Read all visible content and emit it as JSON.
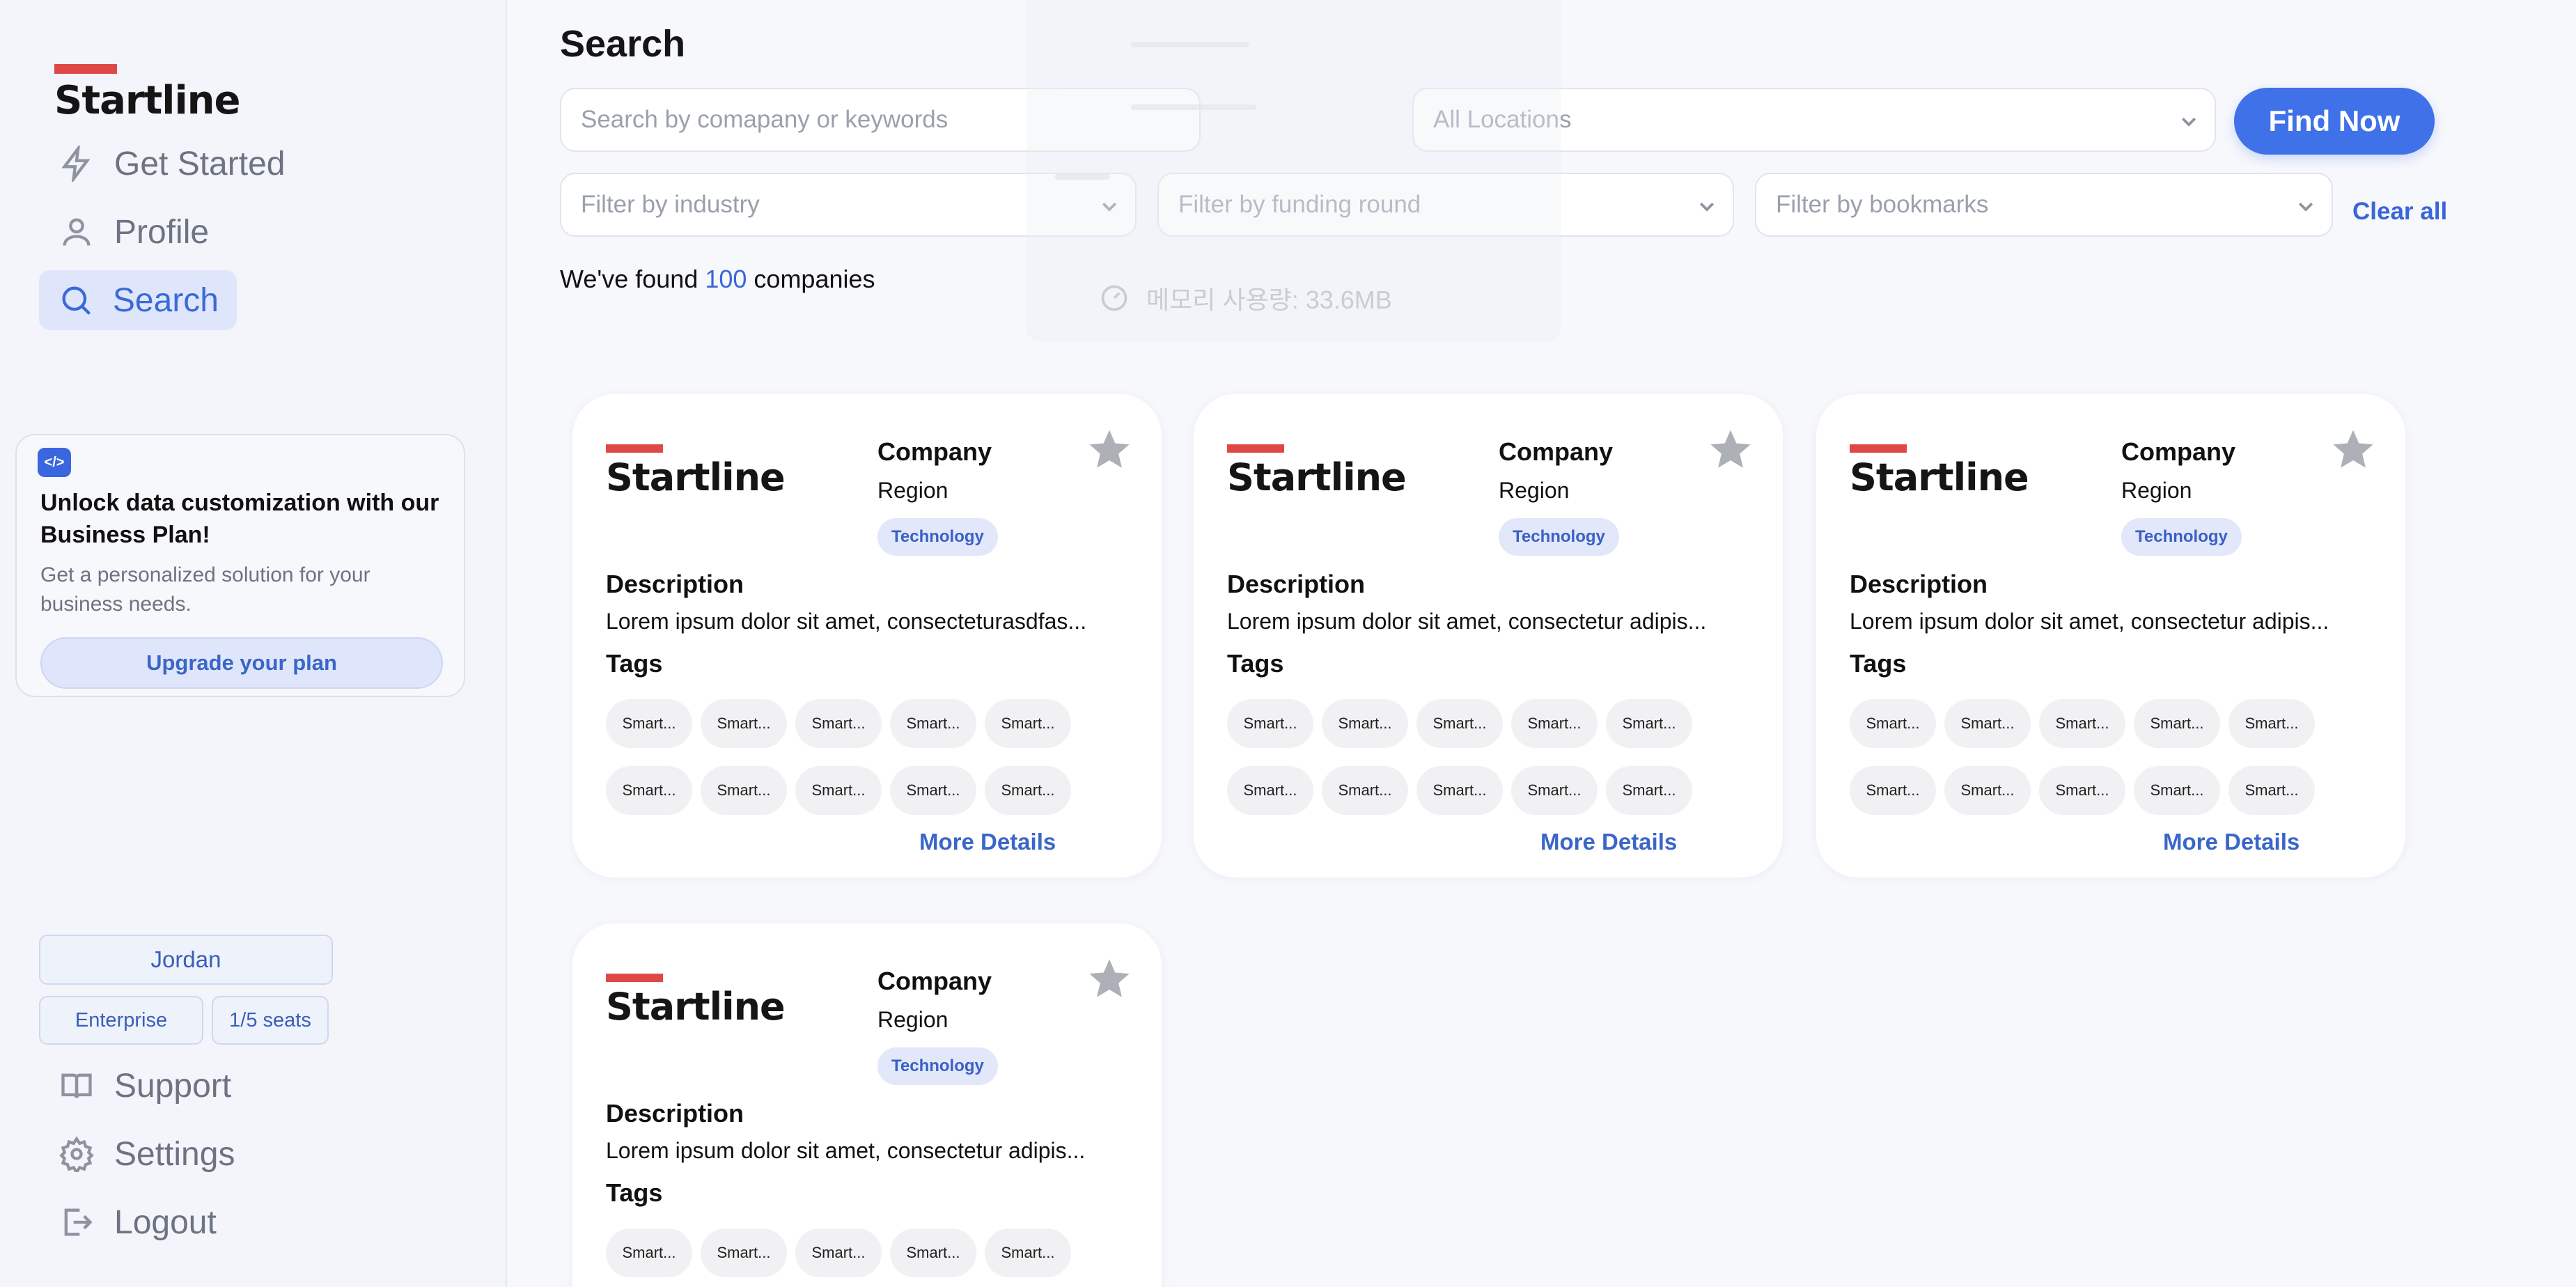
{
  "app": {
    "logo_text": "Startline"
  },
  "sidebar": {
    "nav": [
      {
        "label": "Get Started",
        "icon": "lightning-icon"
      },
      {
        "label": "Profile",
        "icon": "user-icon"
      },
      {
        "label": "Search",
        "icon": "search-icon",
        "active": true
      }
    ],
    "promo": {
      "title": "Unlock data customization with our Business Plan!",
      "text": "Get a personalized solution for your business needs.",
      "button": "Upgrade your plan"
    },
    "user": {
      "name": "Jordan",
      "plan": "Enterprise",
      "seats": "1/5 seats"
    },
    "bottom_nav": [
      {
        "label": "Support",
        "icon": "book-icon"
      },
      {
        "label": "Settings",
        "icon": "gear-icon"
      },
      {
        "label": "Logout",
        "icon": "logout-icon"
      }
    ]
  },
  "main": {
    "title": "Search",
    "search": {
      "placeholder": "Search by comapany or keywords"
    },
    "location": {
      "placeholder": "All Locations"
    },
    "find_button": "Find Now",
    "filters": {
      "industry": "Filter by industry",
      "funding": "Filter by funding round",
      "bookmarks": "Filter by bookmarks"
    },
    "clear_all": "Clear all",
    "results": {
      "prefix": "We've found ",
      "count": "100",
      "suffix": " companies"
    },
    "overlay_text": "메모리 사용량: 33.6MB"
  },
  "cards": [
    {
      "logo": "Startline",
      "company": "Company",
      "region": "Region",
      "badge": "Technology",
      "description_label": "Description",
      "description": "Lorem ipsum dolor sit amet, consecteturasdfas...",
      "tags_label": "Tags",
      "tags": [
        "Smart...",
        "Smart...",
        "Smart...",
        "Smart...",
        "Smart...",
        "Smart...",
        "Smart...",
        "Smart...",
        "Smart...",
        "Smart..."
      ],
      "more": "More Details"
    },
    {
      "logo": "Startline",
      "company": "Company",
      "region": "Region",
      "badge": "Technology",
      "description_label": "Description",
      "description": "Lorem ipsum dolor sit amet, consectetur adipis...",
      "tags_label": "Tags",
      "tags": [
        "Smart...",
        "Smart...",
        "Smart...",
        "Smart...",
        "Smart...",
        "Smart...",
        "Smart...",
        "Smart...",
        "Smart...",
        "Smart..."
      ],
      "more": "More Details"
    },
    {
      "logo": "Startline",
      "company": "Company",
      "region": "Region",
      "badge": "Technology",
      "description_label": "Description",
      "description": "Lorem ipsum dolor sit amet, consectetur adipis...",
      "tags_label": "Tags",
      "tags": [
        "Smart...",
        "Smart...",
        "Smart...",
        "Smart...",
        "Smart...",
        "Smart...",
        "Smart...",
        "Smart...",
        "Smart...",
        "Smart..."
      ],
      "more": "More Details"
    },
    {
      "logo": "Startline",
      "company": "Company",
      "region": "Region",
      "badge": "Technology",
      "description_label": "Description",
      "description": "Lorem ipsum dolor sit amet, consectetur adipis...",
      "tags_label": "Tags",
      "tags": [
        "Smart...",
        "Smart...",
        "Smart...",
        "Smart...",
        "Smart..."
      ],
      "more": ""
    }
  ],
  "colors": {
    "accent": "#3f72e8",
    "logo_red": "#e04848",
    "badge_bg": "#e2e8fa"
  }
}
